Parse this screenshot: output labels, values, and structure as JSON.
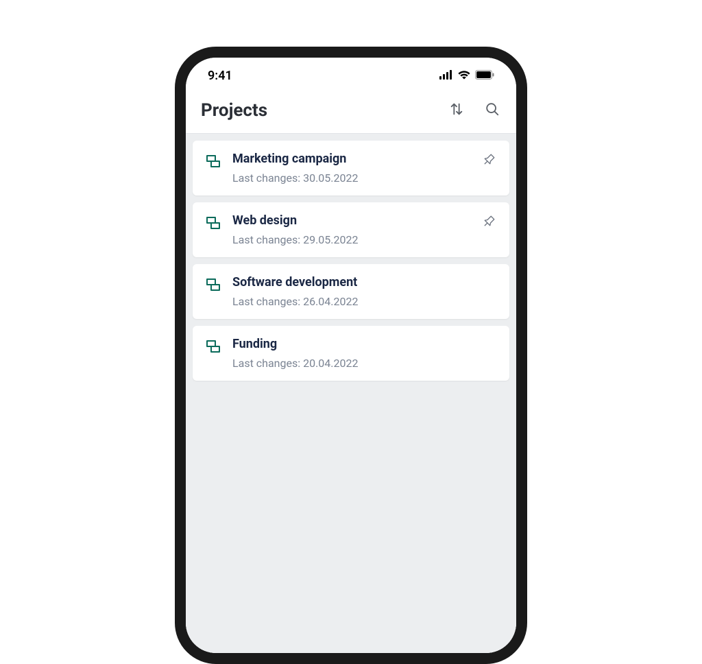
{
  "status_bar": {
    "time": "9:41"
  },
  "header": {
    "title": "Projects"
  },
  "projects": [
    {
      "title": "Marketing campaign",
      "subtitle": "Last changes: 30.05.2022",
      "pinned": true
    },
    {
      "title": "Web design",
      "subtitle": "Last changes: 29.05.2022",
      "pinned": true
    },
    {
      "title": "Software development",
      "subtitle": "Last changes: 26.04.2022",
      "pinned": false
    },
    {
      "title": "Funding",
      "subtitle": "Last changes: 20.04.2022",
      "pinned": false
    }
  ]
}
